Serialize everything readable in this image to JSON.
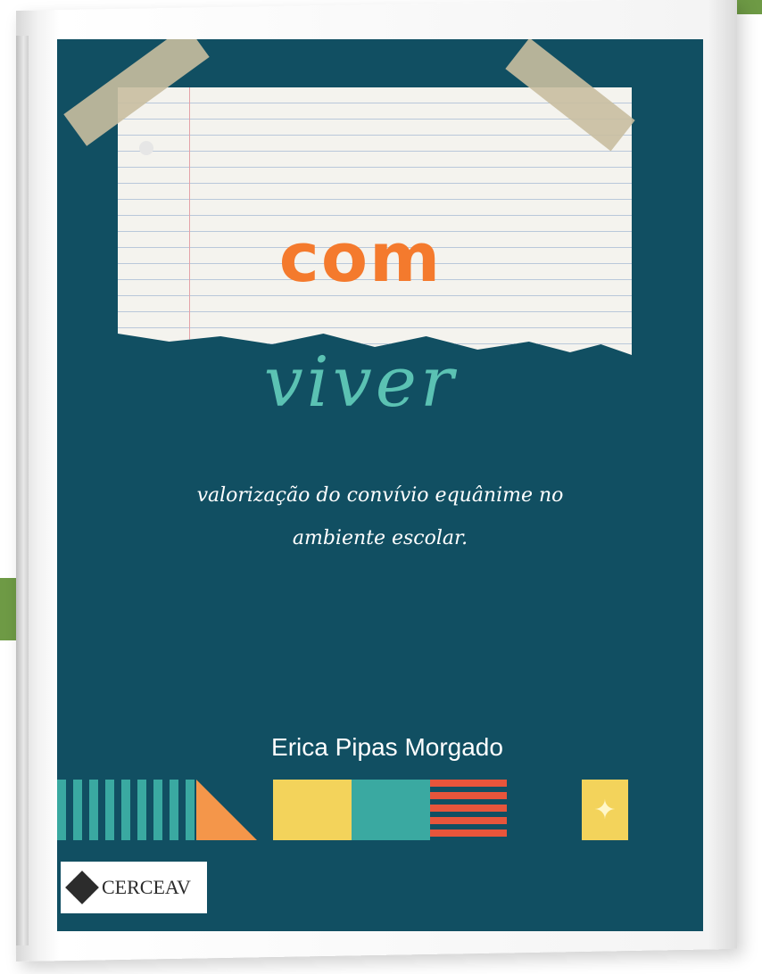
{
  "cover": {
    "title_top": "com",
    "title_bottom": "viver",
    "subtitle_line1": "valorização do convívio equânime no",
    "subtitle_line2": "ambiente escolar.",
    "author": "Erica Pipas Morgado",
    "publisher": "CERCEAV",
    "sparkle": "✦"
  },
  "colors": {
    "cover_bg": "#114f62",
    "orange": "#f47a2d",
    "teal": "#3aa9a1",
    "yellow": "#f3d35b",
    "red": "#e8553b",
    "green_tab": "#6e9a45"
  }
}
